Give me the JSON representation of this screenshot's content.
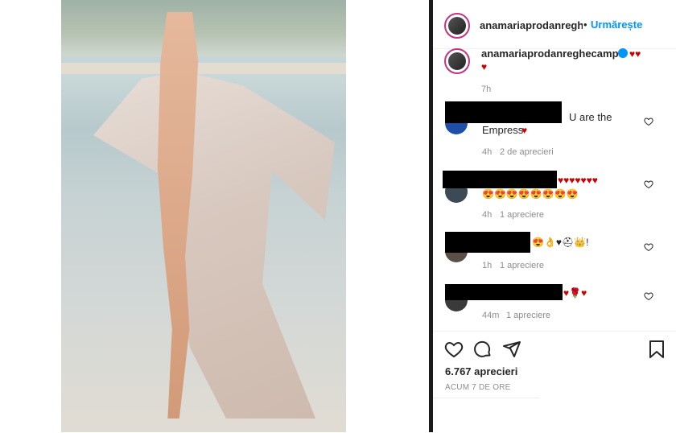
{
  "post": {
    "username": "anamariaprodanreghe",
    "follow_label": "Urmărește",
    "dot": "•",
    "caption_username": "anamariaprodanreghecampi",
    "caption_emojis": "♥♥",
    "caption_emojis2": "♥",
    "caption_time": "7h"
  },
  "comments": [
    {
      "text1": "U are the",
      "text2": "Empress",
      "emoji": "♥",
      "time": "4h",
      "likes": "2 de aprecieri"
    },
    {
      "text1": "♥♥♥♥♥♥♥",
      "text2": "😍😍😍😍😍😍😍😍",
      "time": "4h",
      "likes": "1 apreciere"
    },
    {
      "text1": "😍👌♥⛑👑!",
      "time": "1h",
      "likes": "1 apreciere"
    },
    {
      "text1": "♥🌹♥",
      "time": "44m",
      "likes": "1 apreciere"
    }
  ],
  "footer": {
    "likes": "6.767 aprecieri",
    "time": "ACUM 7 DE ORE"
  },
  "icons": [
    "heart-icon",
    "comment-icon",
    "share-icon",
    "bookmark-icon",
    "verified-icon"
  ],
  "colors": {
    "follow": "#0095f6",
    "heart": "#cc0000",
    "avatar_ring": "#c13584"
  }
}
